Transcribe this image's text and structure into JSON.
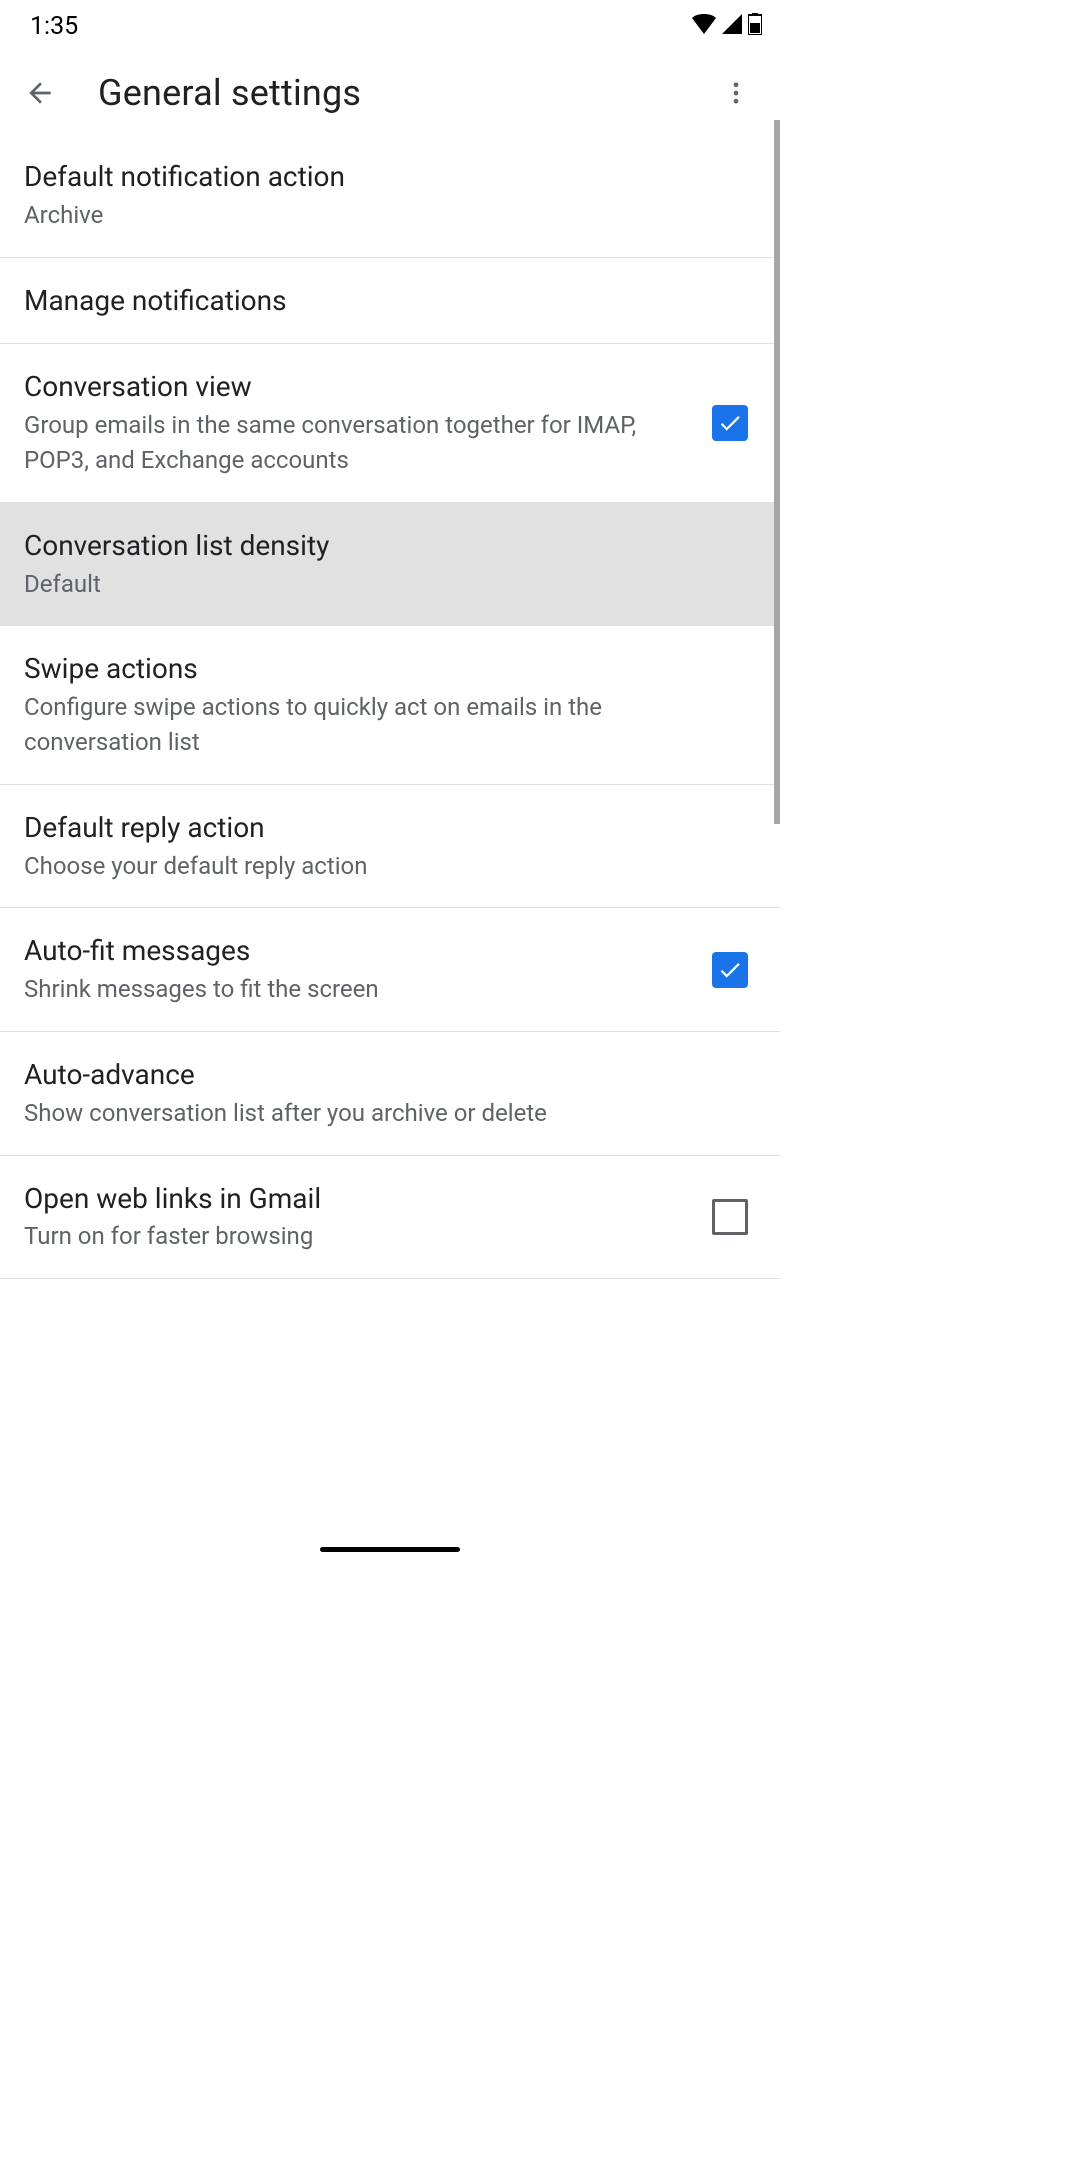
{
  "status": {
    "time": "1:35"
  },
  "header": {
    "title": "General settings"
  },
  "settings": [
    {
      "title": "Default notification action",
      "subtitle": "Archive",
      "type": "link",
      "highlighted": false
    },
    {
      "title": "Manage notifications",
      "subtitle": "",
      "type": "link",
      "highlighted": false
    },
    {
      "title": "Conversation view",
      "subtitle": "Group emails in the same conversation together for IMAP, POP3, and Exchange accounts",
      "type": "checkbox",
      "checked": true,
      "highlighted": false
    },
    {
      "title": "Conversation list density",
      "subtitle": "Default",
      "type": "link",
      "highlighted": true
    },
    {
      "title": "Swipe actions",
      "subtitle": "Configure swipe actions to quickly act on emails in the conversation list",
      "type": "link",
      "highlighted": false
    },
    {
      "title": "Default reply action",
      "subtitle": "Choose your default reply action",
      "type": "link",
      "highlighted": false
    },
    {
      "title": "Auto-fit messages",
      "subtitle": "Shrink messages to fit the screen",
      "type": "checkbox",
      "checked": true,
      "highlighted": false
    },
    {
      "title": "Auto-advance",
      "subtitle": "Show conversation list after you archive or delete",
      "type": "link",
      "highlighted": false
    },
    {
      "title": "Open web links in Gmail",
      "subtitle": "Turn on for faster browsing",
      "type": "checkbox",
      "checked": false,
      "highlighted": false
    }
  ]
}
